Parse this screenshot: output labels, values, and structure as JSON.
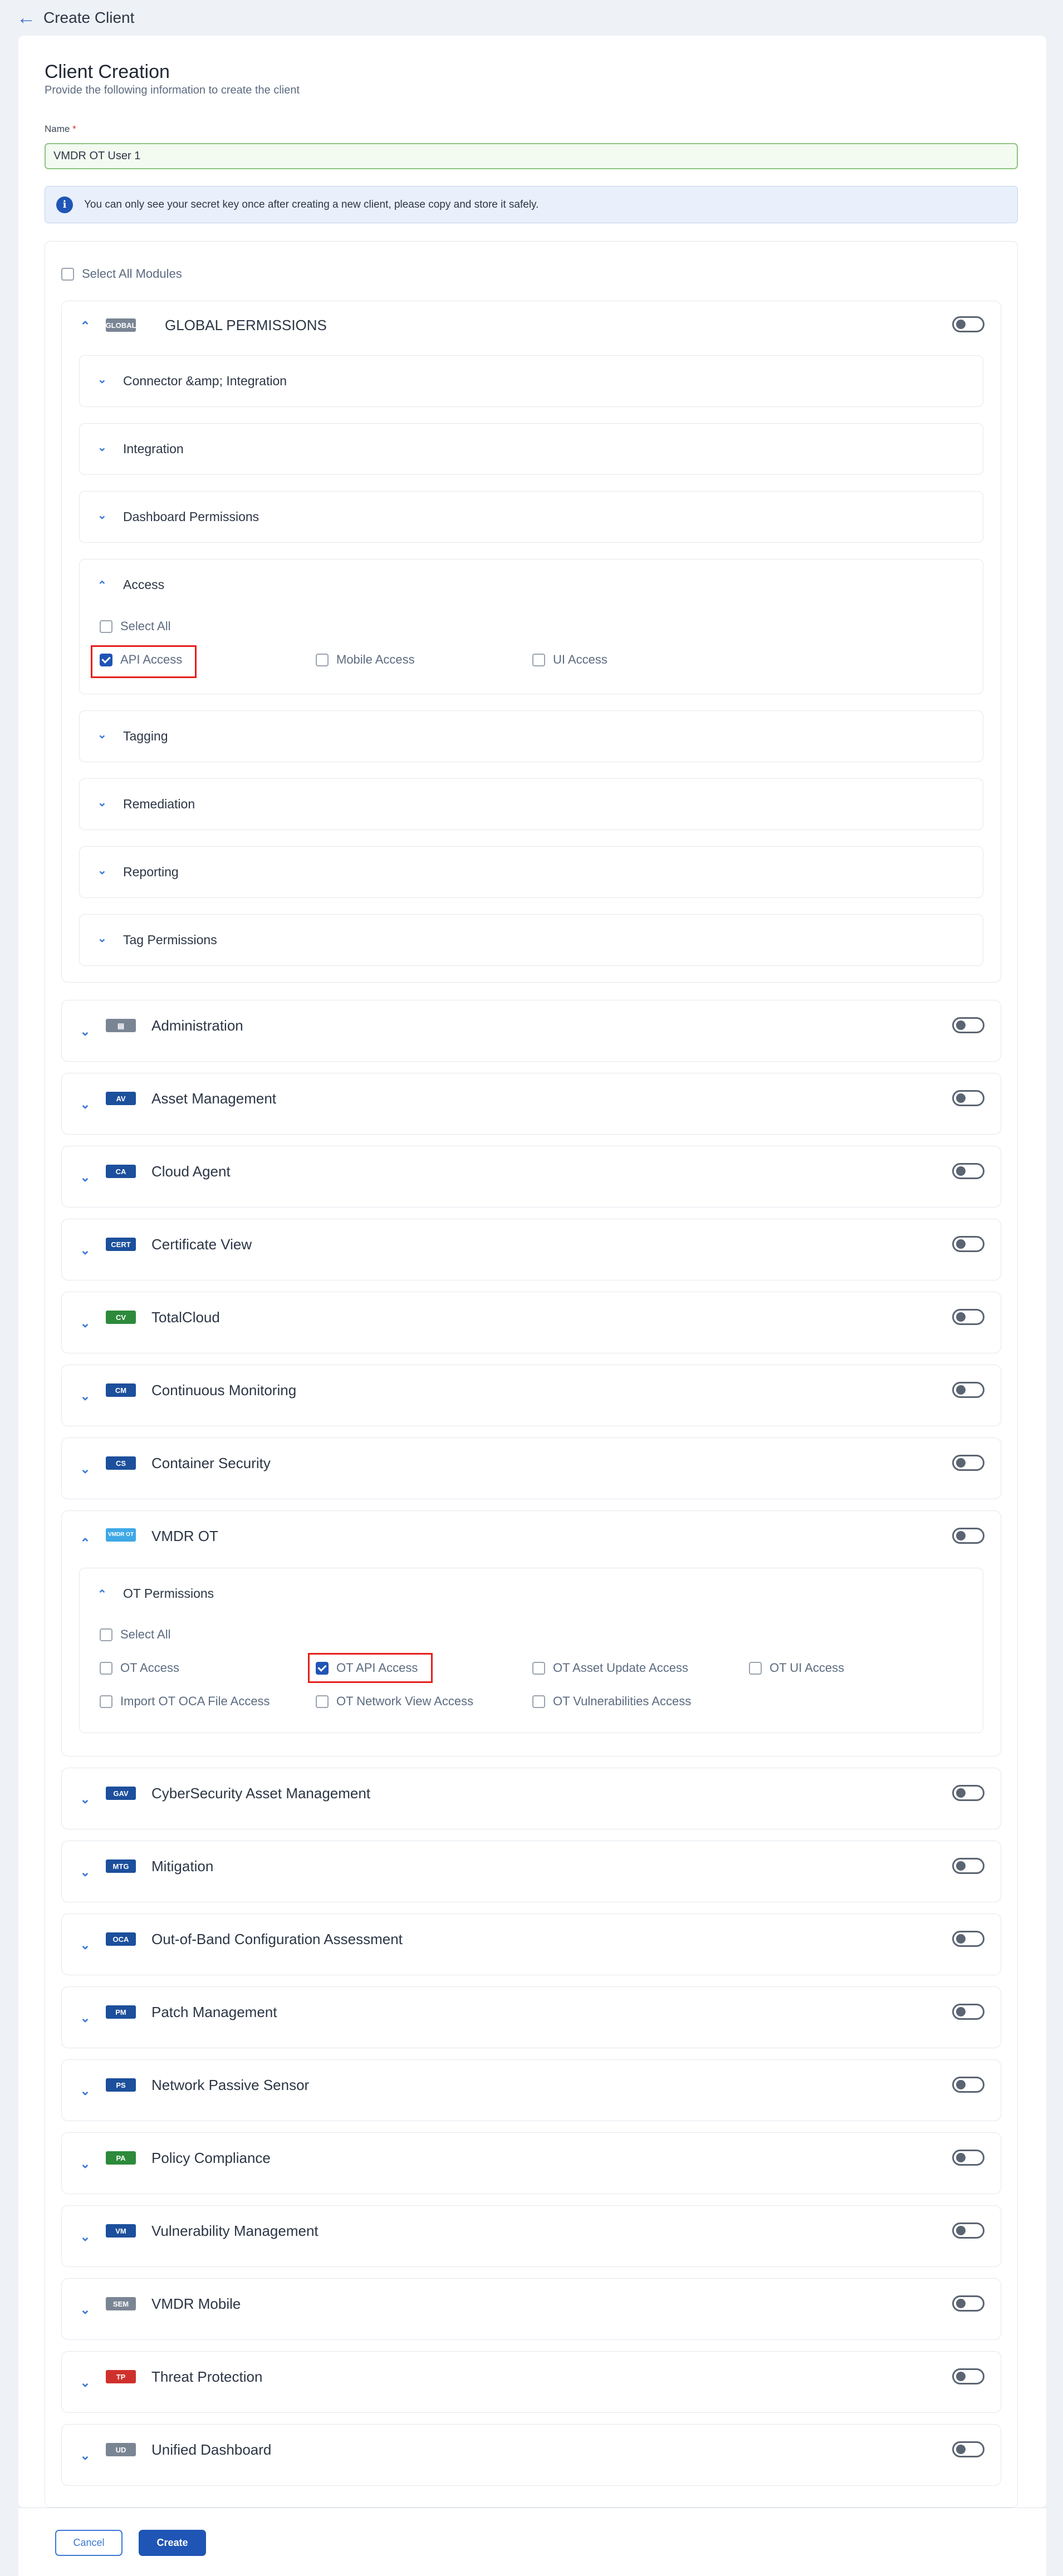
{
  "header": {
    "back_icon": "arrow-left-icon",
    "title": "Create Client"
  },
  "form": {
    "title": "Client Creation",
    "subtitle": "Provide the following information to create the client",
    "name_label": "Name",
    "name_required_mark": "*",
    "name_value": "VMDR OT User 1",
    "info_icon": "info-icon",
    "info_text": "You can only see your secret key once after creating a new client, please copy and store it safely."
  },
  "select_all_modules": {
    "label": "Select All Modules",
    "checked": false
  },
  "global": {
    "badge": "GLOBAL",
    "badge_color": "#7a8594",
    "title": "GLOBAL PERMISSIONS",
    "enabled": false,
    "sections": [
      {
        "label": "Connector &amp; Integration",
        "expanded": false
      },
      {
        "label": "Integration",
        "expanded": false
      },
      {
        "label": "Dashboard Permissions",
        "expanded": false
      },
      {
        "label": "Access",
        "expanded": true,
        "select_all": "Select All",
        "options": [
          {
            "label": "API Access",
            "checked": true
          },
          {
            "label": "Mobile Access",
            "checked": false
          },
          {
            "label": "UI Access",
            "checked": false
          }
        ]
      },
      {
        "label": "Tagging",
        "expanded": false
      },
      {
        "label": "Remediation",
        "expanded": false
      },
      {
        "label": "Reporting",
        "expanded": false
      },
      {
        "label": "Tag Permissions",
        "expanded": false
      }
    ]
  },
  "modules": [
    {
      "badge": "",
      "badge_icon": "document-icon",
      "badge_color": "#7a8594",
      "name": "Administration",
      "enabled": false
    },
    {
      "badge": "AV",
      "badge_color": "#1c4f9c",
      "name": "Asset Management",
      "enabled": false
    },
    {
      "badge": "CA",
      "badge_color": "#1c4f9c",
      "name": "Cloud Agent",
      "enabled": false
    },
    {
      "badge": "CERT",
      "badge_color": "#1c4f9c",
      "name": "Certificate View",
      "enabled": false
    },
    {
      "badge": "CV",
      "badge_color": "#2c8a3a",
      "name": "TotalCloud",
      "enabled": false
    },
    {
      "badge": "CM",
      "badge_color": "#1c4f9c",
      "name": "Continuous Monitoring",
      "enabled": false
    },
    {
      "badge": "CS",
      "badge_color": "#1c4f9c",
      "name": "Container Security",
      "enabled": false
    },
    {
      "badge": "VMDR OT",
      "badge_color": "#3ea9e6",
      "name": "VMDR OT",
      "enabled": false
    },
    {
      "badge": "GAV",
      "badge_color": "#1c4f9c",
      "name": "CyberSecurity Asset Management",
      "enabled": false
    },
    {
      "badge": "MTG",
      "badge_color": "#1c4f9c",
      "name": "Mitigation",
      "enabled": false
    },
    {
      "badge": "OCA",
      "badge_color": "#1c4f9c",
      "name": "Out-of-Band Configuration Assessment",
      "enabled": false
    },
    {
      "badge": "PM",
      "badge_color": "#1c4f9c",
      "name": "Patch Management",
      "enabled": false
    },
    {
      "badge": "PS",
      "badge_color": "#1c4f9c",
      "name": "Network Passive Sensor",
      "enabled": false
    },
    {
      "badge": "PA",
      "badge_color": "#2c8a3a",
      "name": "Policy Compliance",
      "enabled": false
    },
    {
      "badge": "VM",
      "badge_color": "#1c4f9c",
      "name": "Vulnerability Management",
      "enabled": false
    },
    {
      "badge": "SEM",
      "badge_color": "#7a8594",
      "name": "VMDR Mobile",
      "enabled": false
    },
    {
      "badge": "TP",
      "badge_color": "#d0302b",
      "name": "Threat Protection",
      "enabled": false
    },
    {
      "badge": "UD",
      "badge_color": "#7a8594",
      "name": "Unified Dashboard",
      "enabled": false
    }
  ],
  "ot_permissions": {
    "label": "OT Permissions",
    "select_all": "Select All",
    "options": [
      {
        "label": "OT Access",
        "checked": false
      },
      {
        "label": "OT API Access",
        "checked": true
      },
      {
        "label": "OT Asset Update Access",
        "checked": false
      },
      {
        "label": "OT UI Access",
        "checked": false
      },
      {
        "label": "Import OT OCA File Access",
        "checked": false
      },
      {
        "label": "OT Network View Access",
        "checked": false
      },
      {
        "label": "OT Vulnerabilities Access",
        "checked": false
      }
    ]
  },
  "footer": {
    "cancel_label": "Cancel",
    "create_label": "Create"
  },
  "colors": {
    "accent": "#1f55b5",
    "highlight": "#e5201b",
    "valid_border": "#8dc57e"
  }
}
